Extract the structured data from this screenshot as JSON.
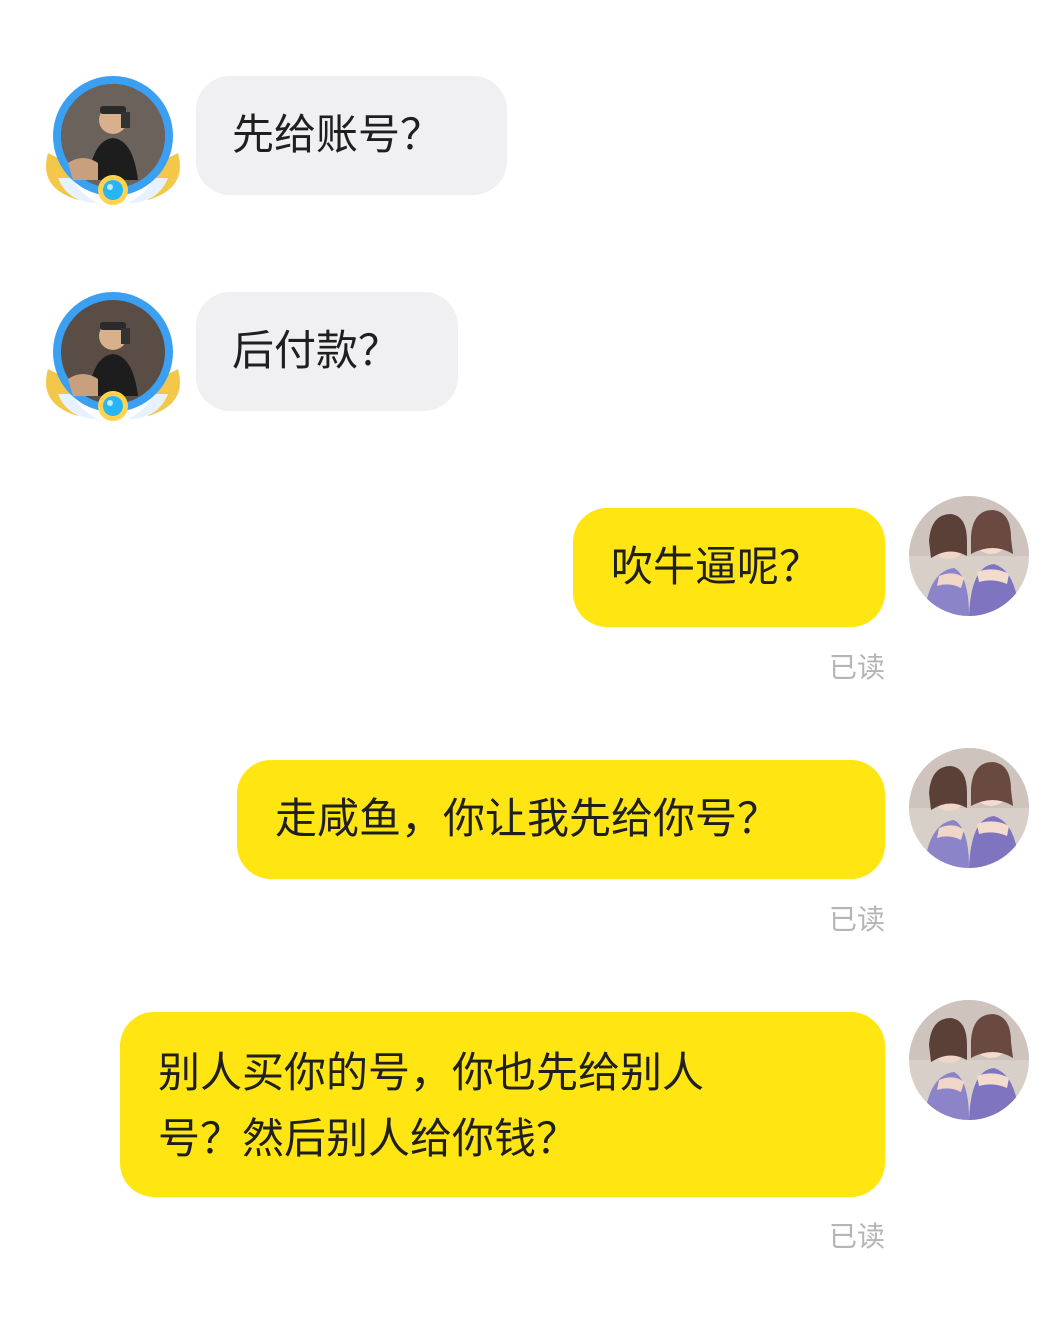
{
  "messages": [
    {
      "sender": "other",
      "text": "先给账号？"
    },
    {
      "sender": "other",
      "text": "后付款？"
    },
    {
      "sender": "me",
      "text": "吹牛逼呢？",
      "status": "已读"
    },
    {
      "sender": "me",
      "text": "走咸鱼，你让我先给你号？",
      "status": "已读"
    },
    {
      "sender": "me",
      "lines": [
        "别人买你的号，你也先给别人",
        "号？然后别人给你钱？"
      ],
      "status": "已读"
    }
  ],
  "colors": {
    "outgoing_bubble": "#ffe512",
    "incoming_bubble": "#f0f0f2",
    "read_status": "#b5b5b5"
  },
  "icons": {
    "other_avatar": "man-selfie-avatar-with-winged-frame",
    "my_avatar": "two-women-photo-avatar"
  }
}
